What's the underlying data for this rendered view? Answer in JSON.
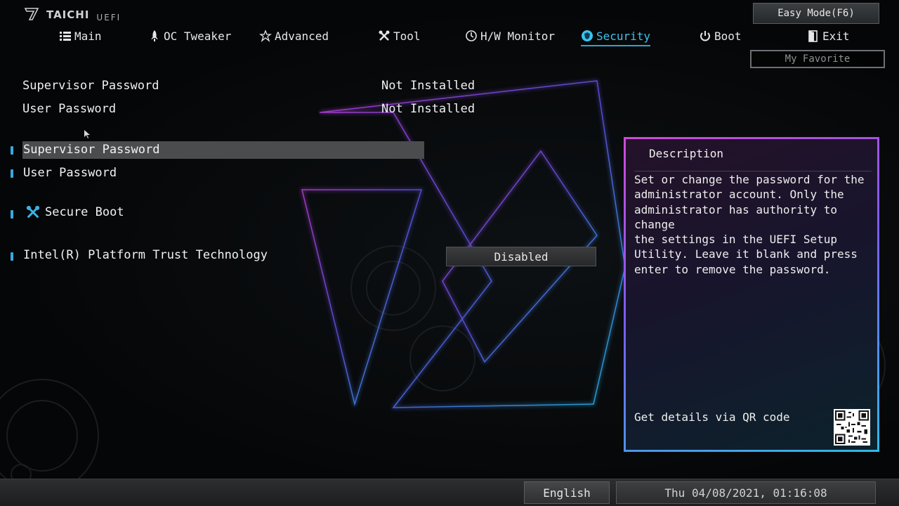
{
  "header": {
    "logo_text": "TAICHI",
    "logo_sub": "UEFI",
    "easy_mode_label": "Easy Mode(F6)",
    "my_favorite_label": "My Favorite"
  },
  "tabs": [
    {
      "label": "Main",
      "icon": "list-icon"
    },
    {
      "label": "OC Tweaker",
      "icon": "rocket-icon"
    },
    {
      "label": "Advanced",
      "icon": "star-icon"
    },
    {
      "label": "Tool",
      "icon": "tools-icon"
    },
    {
      "label": "H/W Monitor",
      "icon": "monitor-icon"
    },
    {
      "label": "Security",
      "icon": "shield-icon",
      "active": true
    },
    {
      "label": "Boot",
      "icon": "power-icon"
    },
    {
      "label": "Exit",
      "icon": "door-icon"
    }
  ],
  "status": [
    {
      "label": "Supervisor Password",
      "value": "Not Installed"
    },
    {
      "label": "User Password",
      "value": "Not Installed"
    }
  ],
  "items": [
    {
      "label": "Supervisor Password",
      "selected": true
    },
    {
      "label": "User Password"
    },
    {
      "label": "Secure Boot",
      "icon": "tools-icon"
    },
    {
      "label": "Intel(R) Platform Trust Technology",
      "value": "Disabled"
    }
  ],
  "description": {
    "title": "Description",
    "text": "Set or change the password for the\nadministrator account. Only the\nadministrator has authority to change\nthe settings in the UEFI Setup\nUtility. Leave it blank and press\nenter to remove the password.",
    "qr_label": "Get details via QR code"
  },
  "footer": {
    "language": "English",
    "datetime": "Thu 04/08/2021, 01:16:08"
  },
  "colors": {
    "accent": "#3bc2ee",
    "bullet": "#37a9e0",
    "panel_border_start": "#d04ad8",
    "panel_border_end": "#2fb9e8"
  }
}
